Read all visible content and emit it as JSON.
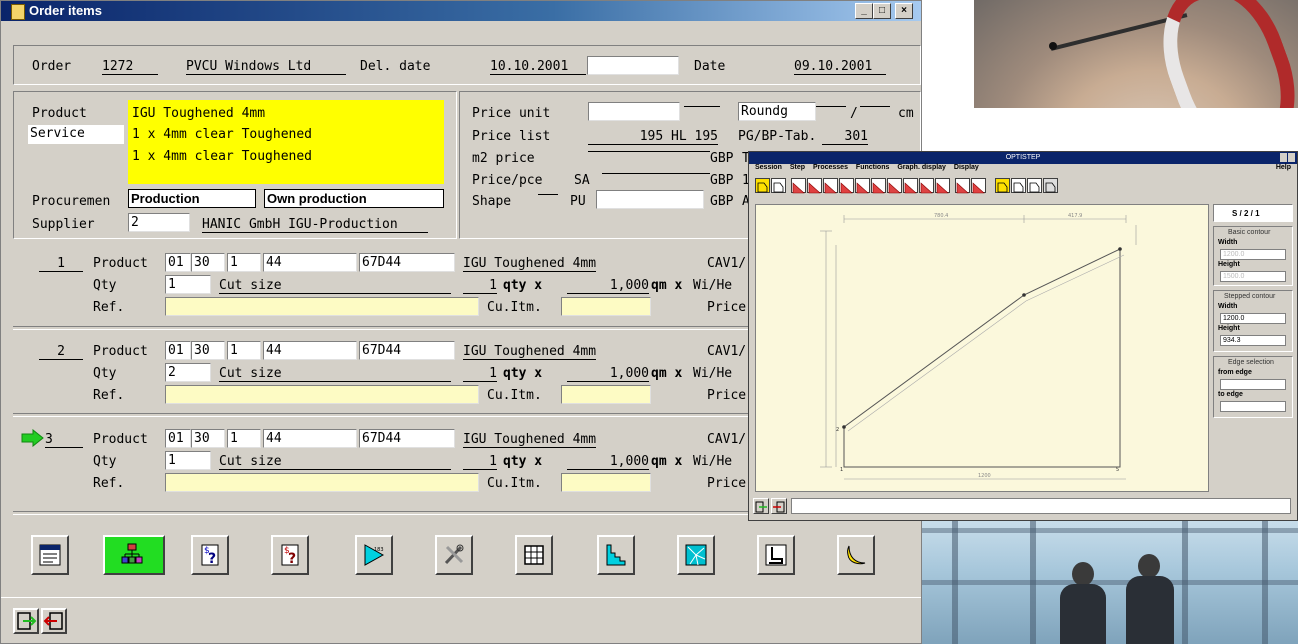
{
  "window": {
    "title": "Order items",
    "min": "_",
    "max": "□",
    "close": "×"
  },
  "header": {
    "order_label": "Order",
    "order_no": "1272",
    "customer": "PVCU Windows Ltd",
    "del_date_label": "Del. date",
    "del_date": "10.10.2001",
    "date_label": "Date",
    "date": "09.10.2001"
  },
  "left": {
    "product_label": "Product",
    "product_value": "IGU Toughened 4mm",
    "service_label": "Service",
    "service_line1": "1 x 4mm clear Toughened",
    "service_line2": "1 x 4mm clear Toughened",
    "procurement_label": "Procuremen",
    "procurement_value": "Production",
    "procurement_value2": "Own production",
    "supplier_label": "Supplier",
    "supplier_no": "2",
    "supplier_name": "HANIC GmbH IGU-Production"
  },
  "right": {
    "price_unit_label": "Price unit",
    "roundg_label": "Roundg",
    "roundg_sep": "/",
    "cm": "cm",
    "price_list_label": "Price list",
    "price_list_value": "195 HL 195",
    "pg_label": "PG/BP-Tab.",
    "pg_value": "301",
    "m2_label": "m2 price",
    "ppce_label": "Price/pce",
    "sa": "SA",
    "shape_label": "Shape",
    "pu": "PU",
    "gbp": "GBP",
    "gbp_t": "T",
    "gbp_1": "1",
    "gbp_a": "A"
  },
  "items": [
    {
      "no": "1",
      "arrow": false,
      "product_label": "Product",
      "c1": "01",
      "c2": "30",
      "c3": "1",
      "c4": "44",
      "c5": "67D44",
      "desc": "IGU Toughened 4mm",
      "cav": "CAV1/",
      "qty_label": "Qty",
      "qty": "1",
      "cut": "Cut size",
      "qn": "1",
      "qtyx": "qty x",
      "qm": "1,000",
      "qmx": "qm x",
      "wihe": "Wi/He",
      "ref_label": "Ref.",
      "cuitm": "Cu.Itm.",
      "price": "Price"
    },
    {
      "no": "2",
      "arrow": false,
      "product_label": "Product",
      "c1": "01",
      "c2": "30",
      "c3": "1",
      "c4": "44",
      "c5": "67D44",
      "desc": "IGU Toughened 4mm",
      "cav": "CAV1/",
      "qty_label": "Qty",
      "qty": "2",
      "cut": "Cut size",
      "qn": "1",
      "qtyx": "qty x",
      "qm": "1,000",
      "qmx": "qm x",
      "wihe": "Wi/He",
      "ref_label": "Ref.",
      "cuitm": "Cu.Itm.",
      "price": "Price"
    },
    {
      "no": "3",
      "arrow": true,
      "product_label": "Product",
      "c1": "01",
      "c2": "30",
      "c3": "1",
      "c4": "44",
      "c5": "67D44",
      "desc": "IGU Toughened 4mm",
      "cav": "CAV1/",
      "qty_label": "Qty",
      "qty": "1",
      "cut": "Cut size",
      "qn": "1",
      "qtyx": "qty x",
      "qm": "1,000",
      "qmx": "qm x",
      "wihe": "Wi/He",
      "ref_label": "Ref.",
      "cuitm": "Cu.Itm.",
      "price": "Price"
    }
  ],
  "toolbar_icons": [
    "form-icon",
    "hierarchy-icon",
    "price-query-icon",
    "price-query-red-icon",
    "measure-shape-icon",
    "tools-icon",
    "grid-icon",
    "step-shape-icon",
    "broken-glass-icon",
    "chair-icon",
    "banana-icon"
  ],
  "optistep": {
    "title": "OPTISTEP",
    "menu": [
      "Session",
      "Step",
      "Processes",
      "Functions",
      "Graph. display",
      "Display"
    ],
    "help": "Help",
    "code": "S / 2 / 1",
    "basic_contour": "Basic contour",
    "width_label": "Width",
    "width_basic": "1200.0",
    "height_label": "Height",
    "height_basic": "1500.0",
    "stepped_contour": "Stepped contour",
    "width_stepped": "1200.0",
    "height_stepped": "934.3",
    "edge_selection": "Edge selection",
    "from_edge": "from edge",
    "to_edge": "to edge",
    "dim_top_left": "780.4",
    "dim_top_right": "417.9",
    "dim_bottom": "1200"
  },
  "colors": {
    "window_bg": "#d4d0c8",
    "title_bar": "#0a246a",
    "highlight": "#ffff00",
    "ref_field": "#fdfbc4",
    "arrow": "#22cc22"
  }
}
